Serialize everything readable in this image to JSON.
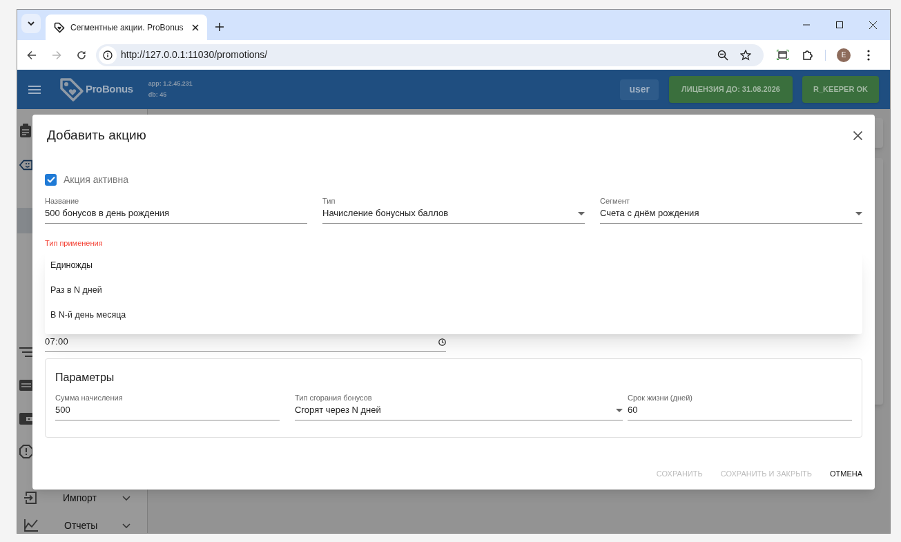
{
  "browser": {
    "tab_title": "Сегментные акции. ProBonus",
    "url": "http://127.0.0.1:11030/promotions/",
    "profile_initial": "E"
  },
  "app_header": {
    "brand": "ProBonus",
    "app_version": "app: 1.2.45.231",
    "db_version": "db: 45",
    "user": "user",
    "license": "ЛИЦЕНЗИЯ ДО: 31.08.2026",
    "status": "R_KEEPER OK"
  },
  "sidebar": {
    "items": [
      {
        "kind": "icon",
        "selected": false
      },
      {
        "kind": "icon",
        "selected": false
      },
      {
        "kind": "row",
        "selected": true
      },
      {
        "kind": "icon",
        "selected": false
      },
      {
        "kind": "icon",
        "selected": false
      },
      {
        "kind": "icon",
        "selected": false
      },
      {
        "kind": "icon",
        "selected": false
      },
      {
        "kind": "group",
        "label": "Импорт",
        "selected": false
      },
      {
        "kind": "group",
        "label": "Отчеты",
        "selected": false
      }
    ]
  },
  "dialog": {
    "title": "Добавить акцию",
    "active": {
      "label": "Акция активна",
      "checked": true
    },
    "fields": [
      {
        "kind": "text",
        "label": "Название",
        "value": "500 бонусов в день рождения"
      },
      {
        "kind": "select",
        "label": "Тип",
        "value": "Начисление бонусных баллов"
      },
      {
        "kind": "select",
        "label": "Сегмент",
        "value": "Счета с днём рождения"
      }
    ],
    "application_type": {
      "label": "Тип применения",
      "error": true,
      "options": [
        {
          "label": "Единожды",
          "selected": false
        },
        {
          "label": "Раз в N дней",
          "selected": false
        },
        {
          "label": "В N-й день месяца",
          "selected": false
        }
      ]
    },
    "time_field": {
      "value": "07:00"
    },
    "parameters": {
      "title": "Параметры",
      "fields": [
        {
          "kind": "text",
          "label": "Сумма начисления",
          "value": "500"
        },
        {
          "kind": "select",
          "label": "Тип сгорания бонусов",
          "value": "Сгорят через N дней"
        },
        {
          "kind": "text",
          "label": "Срок жизни (дней)",
          "value": "60"
        }
      ]
    },
    "buttons": [
      {
        "label": "СОХРАНИТЬ",
        "disabled": true
      },
      {
        "label": "СОХРАНИТЬ И ЗАКРЫТЬ",
        "disabled": true
      },
      {
        "label": "ОТМЕНА",
        "disabled": false
      }
    ]
  }
}
